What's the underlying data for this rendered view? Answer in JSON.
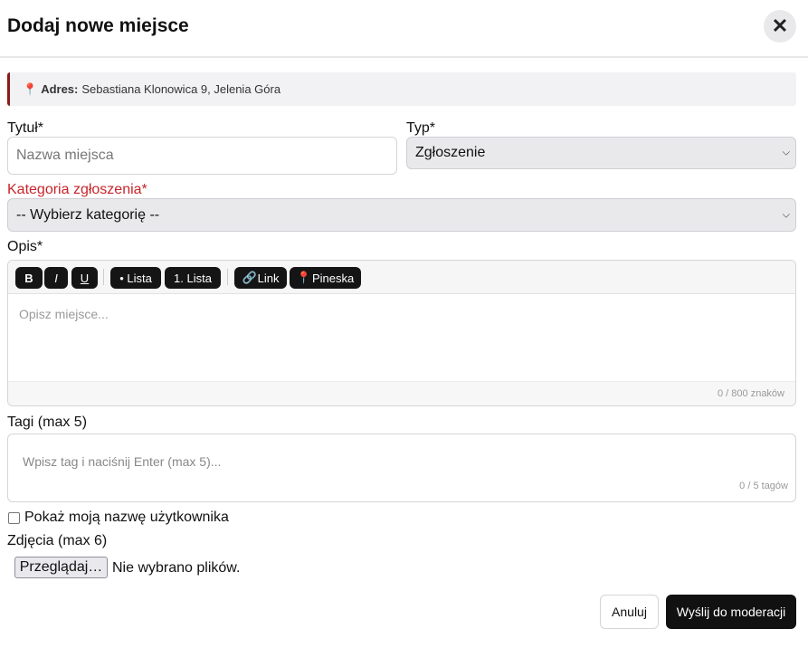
{
  "dialog": {
    "title": "Dodaj nowe miejsce",
    "close_icon": "close-icon"
  },
  "address": {
    "icon": "pin-icon",
    "label": "Adres:",
    "value": "Sebastiana Klonowica 9, Jelenia Góra"
  },
  "form": {
    "title_label": "Tytuł*",
    "title_placeholder": "Nazwa miejsca",
    "type_label": "Typ*",
    "type_value": "Zgłoszenie",
    "category_label": "Kategoria zgłoszenia*",
    "category_value": "-- Wybierz kategorię --",
    "description_label": "Opis*",
    "toolbar": {
      "bold": "B",
      "italic": "I",
      "underline": "U",
      "bullet_list": "• Lista",
      "numbered_list": "1. Lista",
      "link": "Link",
      "link_icon": "link-icon",
      "pin": "Pineska",
      "pin_icon": "pin-icon"
    },
    "description_placeholder": "Opisz miejsce...",
    "description_counter": "0 / 800 znaków",
    "tags_label": "Tagi (max 5)",
    "tags_placeholder": "Wpisz tag i naciśnij Enter (max 5)...",
    "tags_counter": "0 / 5 tagów",
    "show_username_label": "Pokaż moją nazwę użytkownika",
    "show_username_checked": false,
    "photos_label": "Zdjęcia (max 6)",
    "browse_button": "Przeglądaj…",
    "file_status": "Nie wybrano plików."
  },
  "actions": {
    "cancel": "Anuluj",
    "submit": "Wyślij do moderacji"
  },
  "colors": {
    "accent": "#111111",
    "required_category": "#c8242a",
    "address_border": "#8b1a1a"
  }
}
